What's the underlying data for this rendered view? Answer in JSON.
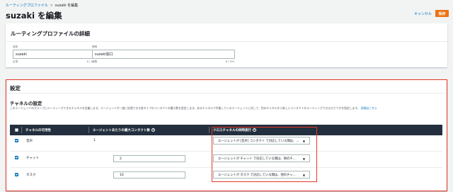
{
  "breadcrumb": {
    "parent": "ルーティングプロファイル",
    "separator": ">",
    "current": "suzaki を編集"
  },
  "page_title": "suzaki を編集",
  "actions": {
    "cancel": "キャンセル",
    "save": "保存"
  },
  "details": {
    "header": "ルーティングプロファイルの詳細",
    "name": {
      "label": "名前",
      "value": "suzaki",
      "hint": "必須",
      "count": "6 / 127"
    },
    "description": {
      "label": "説明",
      "value": "suzaki窓口",
      "hint": "必須",
      "count": "8 / 250"
    }
  },
  "settings": {
    "title": "設定",
    "channels_title": "チャネルの設定",
    "description": "このエージェントのグループにルーティングできるチャネルを定義します。エージェントが一度に処理できる各タイプのコンタクトの最大数を設定します。あるチャネルで作業しているエージェントに対して、別のチャネルから新しいコンタクトをルーティングできるかどうかを指定します。",
    "learn_more": "詳細はこちら"
  },
  "table": {
    "columns": [
      "チャネルの可用性",
      "エージェントあたりの最大コンタクト数",
      "クロスチャネルの同時実行"
    ],
    "rows": [
      {
        "channel": "音声",
        "checked": true,
        "max_contacts": "1",
        "cross_channel": "エージェントが [音声] コンタクト で対応している間は、..."
      },
      {
        "channel": "チャット",
        "checked": true,
        "max_contacts": "2",
        "cross_channel": "エージェントが チャット で対応している間は、他のチ..."
      },
      {
        "channel": "タスク",
        "checked": true,
        "max_contacts": "10",
        "cross_channel": "エージェントが タスク で対応している間は、他のチャ..."
      }
    ]
  },
  "icons": [
    "info-icon",
    "caret-down-icon",
    "checkbox-icon"
  ],
  "colors": {
    "accent": "#ec7211",
    "link": "#0073bb",
    "header_dark": "#232f3e",
    "highlight": "#e5382a"
  }
}
